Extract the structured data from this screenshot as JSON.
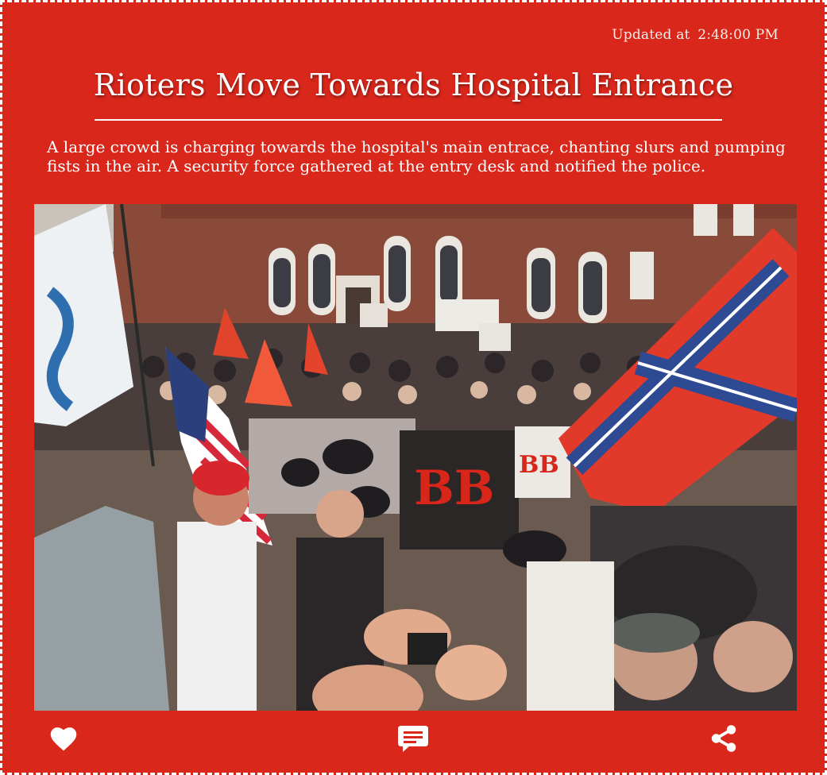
{
  "post": {
    "updated_prefix": "Updated at",
    "updated_time": "2:48:00 PM",
    "headline": "Rioters Move Towards Hospital Entrance",
    "summary": "A large crowd is charging towards the hospital's main entrace, chanting slurs and pumping fists in the air. A security force gathered at the entry desk and notified the police.",
    "image": {
      "sign_text_1": "BB",
      "sign_text_2": "BB"
    }
  },
  "actions": {
    "like_icon": "heart-icon",
    "comment_icon": "comment-icon",
    "share_icon": "share-icon"
  },
  "colors": {
    "background": "#d9271b",
    "text": "#ffffff"
  }
}
